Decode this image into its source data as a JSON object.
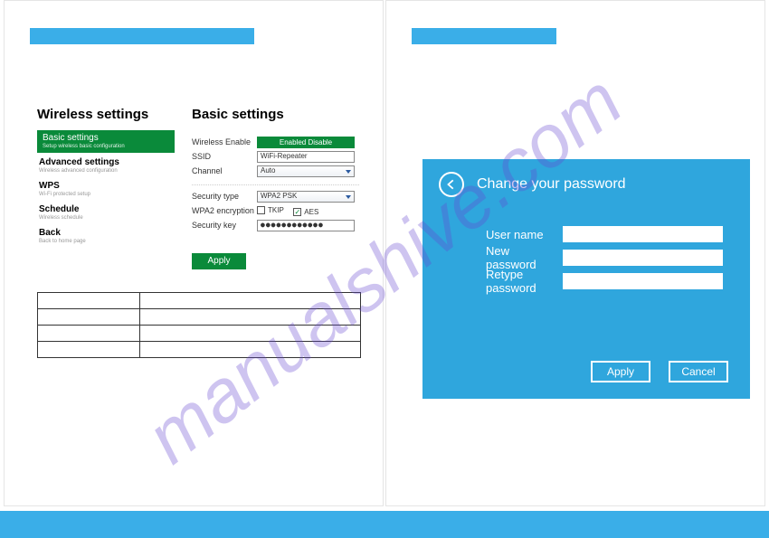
{
  "watermark": "manualshive.com",
  "left": {
    "wireless_title": "Wireless settings",
    "basic_title": "Basic settings",
    "sidebar": [
      {
        "label": "Basic settings",
        "sub": "Setup wireless basic configuration"
      },
      {
        "label": "Advanced settings",
        "sub": "Wireless advanced configuration"
      },
      {
        "label": "WPS",
        "sub": "Wi-Fi protected setup"
      },
      {
        "label": "Schedule",
        "sub": "Wireless schedule"
      },
      {
        "label": "Back",
        "sub": "Back to home page"
      }
    ],
    "form": {
      "wireless_enable_label": "Wireless Enable",
      "wireless_enable_value": "Enabled Disable",
      "ssid_label": "SSID",
      "ssid_value": "WiFi-Repeater",
      "channel_label": "Channel",
      "channel_value": "Auto",
      "sectype_label": "Security type",
      "sectype_value": "WPA2 PSK",
      "wpa2enc_label": "WPA2 encryption",
      "tkip_label": "TKIP",
      "aes_label": "AES",
      "seckey_label": "Security key",
      "seckey_value": "●●●●●●●●●●●●",
      "apply": "Apply"
    }
  },
  "right": {
    "title": "Change your password",
    "username_label": "User name",
    "newpass_label": "New password",
    "retype_label": "Retype password",
    "apply": "Apply",
    "cancel": "Cancel"
  }
}
